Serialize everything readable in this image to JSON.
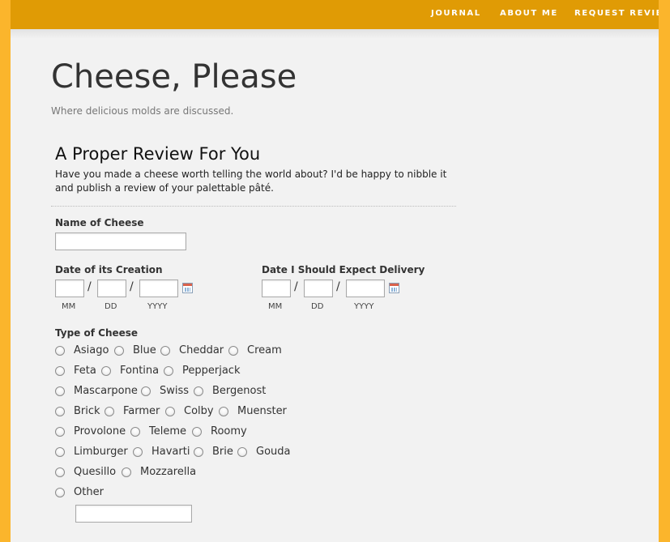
{
  "nav": {
    "items": [
      "JOURNAL",
      "ABOUT ME",
      "REQUEST REVIEW"
    ]
  },
  "site": {
    "title": "Cheese, Please",
    "tagline": "Where delicious molds are discussed."
  },
  "form": {
    "title": "A Proper Review For You",
    "description": "Have you made a cheese worth telling the world about? I'd be happy to nibble it and publish a review of your palettable pâté.",
    "name_label": "Name of Cheese",
    "name_value": "",
    "creation_date": {
      "label": "Date of its Creation",
      "mm": "MM",
      "dd": "DD",
      "yyyy": "YYYY",
      "separator": "/"
    },
    "delivery_date": {
      "label": "Date I Should Expect Delivery",
      "mm": "MM",
      "dd": "DD",
      "yyyy": "YYYY",
      "separator": "/"
    },
    "type_label": "Type of Cheese",
    "types": [
      [
        "Asiago",
        "Blue",
        "Cheddar",
        "Cream"
      ],
      [
        "Feta",
        "Fontina",
        "Pepperjack"
      ],
      [
        "Mascarpone",
        "Swiss",
        "Bergenost"
      ],
      [
        "Brick",
        "Farmer",
        "Colby",
        "Muenster"
      ],
      [
        "Provolone",
        "Teleme",
        "Roomy"
      ],
      [
        "Limburger",
        "Havarti",
        "Brie",
        "Gouda"
      ],
      [
        "Quesillo",
        "Mozzarella"
      ],
      [
        "Other"
      ]
    ],
    "other_value": ""
  },
  "colors": {
    "border": "#fbb52c",
    "topbar": "#e09b05",
    "background": "#f2f2f2"
  },
  "icons": {
    "calendar": "calendar-icon"
  }
}
